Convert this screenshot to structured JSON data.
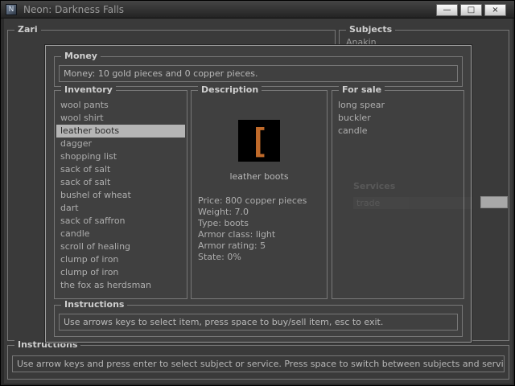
{
  "window": {
    "title": "Neon: Darkness Falls",
    "minimize_label": "—",
    "maximize_label": "□",
    "close_label": "×",
    "icon_glyph": "N"
  },
  "screen": {
    "left_panel_legend": "Zari",
    "subjects": {
      "legend": "Subjects",
      "partial_item": "Anakin"
    },
    "services_ghost": {
      "legend": "Services",
      "selected_item": "trade"
    },
    "instructions": {
      "legend": "Instructions",
      "text": "Use arrow keys and press enter to select subject or service. Press space to switch between subjects and services, esc to q"
    }
  },
  "dialog": {
    "money": {
      "legend": "Money",
      "text": "Money: 10 gold pieces and 0 copper pieces."
    },
    "inventory": {
      "legend": "Inventory",
      "selected_index": 2,
      "items": [
        "wool pants",
        "wool shirt",
        "leather boots",
        "dagger",
        "shopping list",
        "sack of salt",
        "sack of salt",
        "bushel of wheat",
        "dart",
        "sack of saffron",
        "candle",
        "scroll of healing",
        "clump of iron",
        "clump of iron",
        "the fox as herdsman"
      ]
    },
    "description": {
      "legend": "Description",
      "icon_glyph": "[",
      "item_name": "leather boots",
      "stats": [
        "Price: 800 copper pieces",
        "Weight: 7.0",
        "Type: boots",
        "Armor class: light",
        "Armor rating: 5",
        "State: 0%"
      ]
    },
    "for_sale": {
      "legend": "For sale",
      "items": [
        "long spear",
        "buckler",
        "candle"
      ]
    },
    "instructions": {
      "legend": "Instructions",
      "text": "Use arrows keys to select item, press space to buy/sell item, esc to exit."
    }
  },
  "colors": {
    "background": "#3a3a3a",
    "dialog_background": "#404040",
    "selection": "#b5b5b5",
    "accent_orange": "#c06a2a",
    "text": "#aeaeae"
  }
}
